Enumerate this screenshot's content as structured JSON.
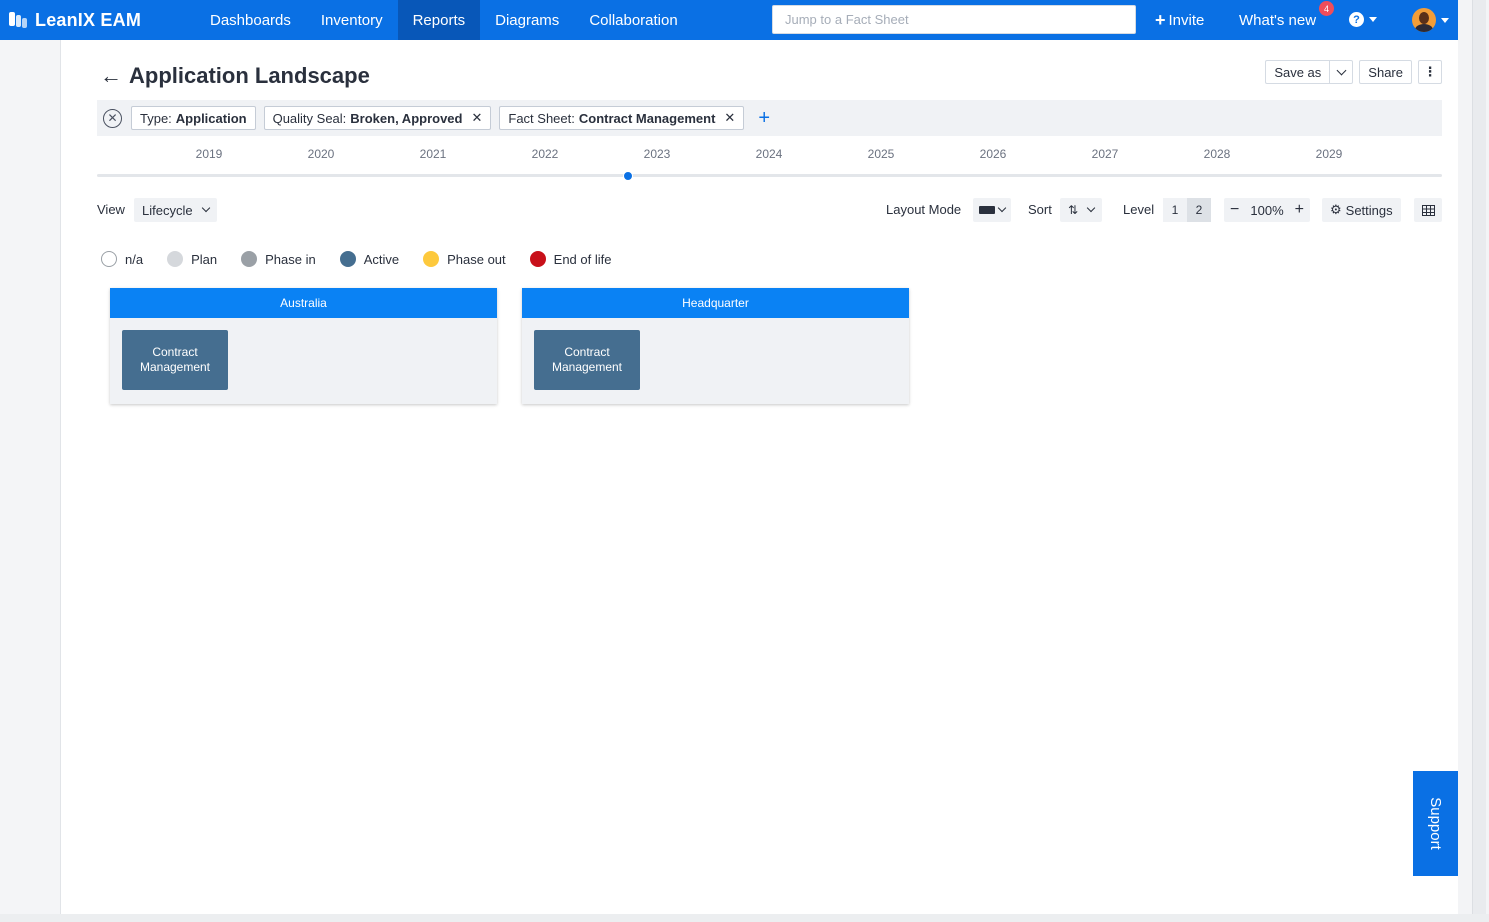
{
  "app": {
    "name": "LeanIX EAM"
  },
  "nav": {
    "items": [
      {
        "label": "Dashboards"
      },
      {
        "label": "Inventory"
      },
      {
        "label": "Reports"
      },
      {
        "label": "Diagrams"
      },
      {
        "label": "Collaboration"
      }
    ],
    "active": "Reports",
    "search_placeholder": "Jump to a Fact Sheet",
    "invite_label": "Invite",
    "whats_new_label": "What's new",
    "whats_new_count": "4",
    "help_glyph": "?"
  },
  "page": {
    "title": "Application Landscape",
    "save_as_label": "Save as",
    "share_label": "Share"
  },
  "filters": [
    {
      "key": "Type:",
      "value": "Application",
      "removable": false
    },
    {
      "key": "Quality Seal:",
      "value": "Broken, Approved",
      "removable": true
    },
    {
      "key": "Fact Sheet:",
      "value": "Contract Management",
      "removable": true
    }
  ],
  "timeline": {
    "years": [
      "2019",
      "2020",
      "2021",
      "2022",
      "2023",
      "2024",
      "2025",
      "2026",
      "2027",
      "2028",
      "2029"
    ],
    "selected_year_fraction": 0.395
  },
  "toolbar": {
    "view_label": "View",
    "view_value": "Lifecycle",
    "layout_mode_label": "Layout Mode",
    "sort_label": "Sort",
    "level_label": "Level",
    "levels": [
      "1",
      "2"
    ],
    "level_selected": "2",
    "zoom_minus": "−",
    "zoom_value": "100%",
    "zoom_plus": "+",
    "settings_label": "Settings"
  },
  "legend": [
    {
      "label": "n/a",
      "color": "#ffffff",
      "outline": true
    },
    {
      "label": "Plan",
      "color": "#d5d8dc"
    },
    {
      "label": "Phase in",
      "color": "#9aa0a6"
    },
    {
      "label": "Active",
      "color": "#456e90"
    },
    {
      "label": "Phase out",
      "color": "#fdc93d"
    },
    {
      "label": "End of life",
      "color": "#c8101a"
    }
  ],
  "groups": [
    {
      "title": "Australia",
      "apps": [
        {
          "name": "Contract Management"
        }
      ]
    },
    {
      "title": "Headquarter",
      "apps": [
        {
          "name": "Contract Management"
        }
      ]
    }
  ],
  "support": {
    "label": "Support"
  },
  "colors": {
    "brand": "#0a70e4",
    "group_header": "#0a82f4",
    "active_app": "#456e90"
  }
}
